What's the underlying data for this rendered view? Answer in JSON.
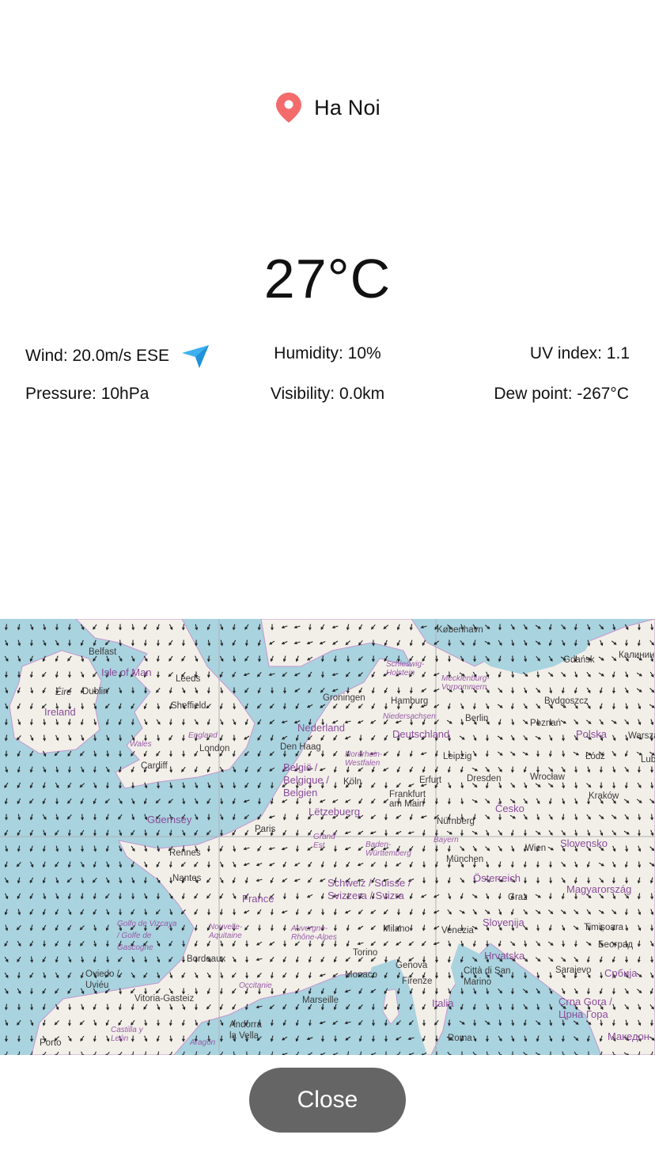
{
  "location": {
    "city": "Ha Noi",
    "icon": "map-pin-icon",
    "icon_color": "#f36b6b"
  },
  "temperature": "27°C",
  "stats": {
    "wind": "Wind: 20.0m/s ESE",
    "wind_icon": "wind-direction-arrow-icon",
    "wind_icon_color": "#3db0f0",
    "humidity": "Humidity: 10%",
    "uv": "UV index: 1.1",
    "pressure": "Pressure: 10hPa",
    "visibility": "Visibility: 0.0km",
    "dew_point": "Dew point: -267°C"
  },
  "map": {
    "colors": {
      "water": "#a9d3df",
      "land": "#f2efe9",
      "border": "#c596cf"
    },
    "places": [
      "København",
      "Gdańsk",
      "Калинин",
      "Belfast",
      "Isle of Man",
      "Leeds",
      "Ireland",
      "Dublin",
      "Éire",
      "Sheffield",
      "Groningen",
      "Hamburg",
      "Bydgoszcz",
      "Schleswig-Holstein",
      "Mecklenburg-Vorpommern",
      "Niedersachsen",
      "Berlin",
      "Poznań",
      "Nederland",
      "Deutschland",
      "Polska",
      "Warszawa",
      "Wales",
      "England",
      "London",
      "Den Haag",
      "Cardiff",
      "België / Belgique / Belgien",
      "Nordrhein-Westfalen",
      "Leipzig",
      "Dresden",
      "Łódź",
      "Lub",
      "Köln",
      "Erfurt",
      "Frankfurt am Main",
      "Wrocław",
      "Kraków",
      "Lëtzebuerg",
      "Česko",
      "Guernsey",
      "Paris",
      "Grand Est",
      "Nürnberg",
      "Baden-Württemberg",
      "Bayern",
      "Slovensko",
      "Rennes",
      "München",
      "Wien",
      "Nantes",
      "Schweiz / Suisse / Svizzera / Svizra",
      "Österreich",
      "Magyarország",
      "France",
      "Graz",
      "Golfo de Vizcaya / Golfe de Gascogne",
      "Nouvelle-Aquitaine",
      "Auvergne-Rhône-Alpes",
      "Milano",
      "Venezia",
      "Slovenija",
      "Timișoara",
      "Београд",
      "Bordeaux",
      "Torino",
      "Genova",
      "Hrvatska",
      "Oviedo / Uviéu",
      "Monaco",
      "Firenze",
      "Città di San Marino",
      "Sarajevo",
      "Србија",
      "Occitanie",
      "Vitoria-Gasteiz",
      "Marseille",
      "Italia",
      "Crna Gora / Црна Гора",
      "Andorra la Vella",
      "Castilla y León",
      "Aragón",
      "Porto",
      "Roma",
      "Македон"
    ]
  },
  "close_label": "Close"
}
